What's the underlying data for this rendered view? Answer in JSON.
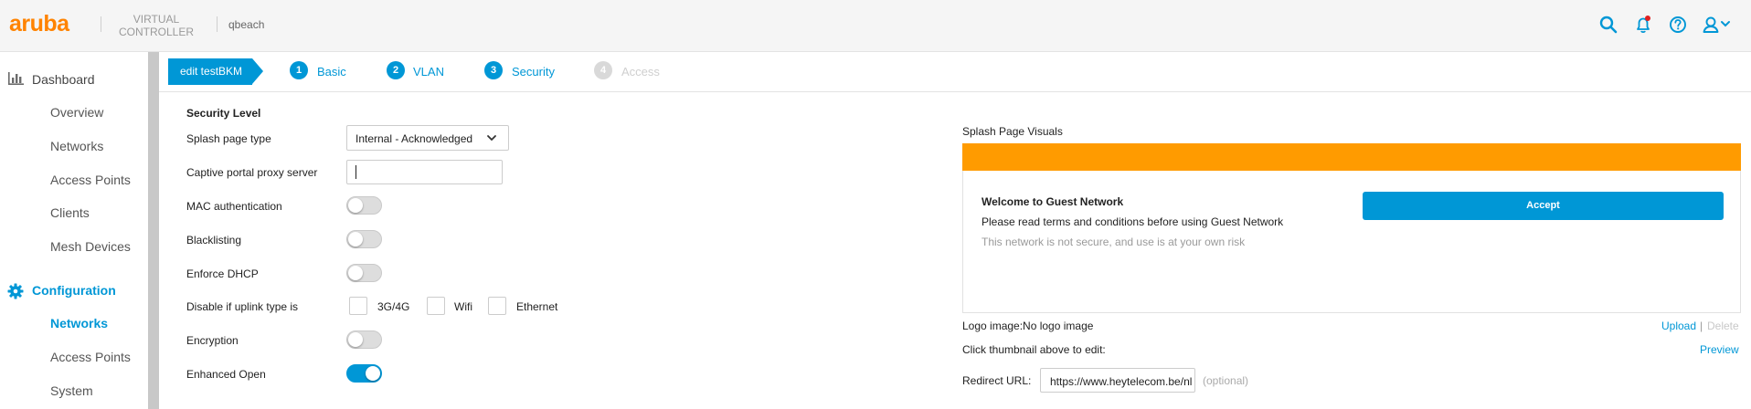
{
  "header": {
    "logo": "aruba",
    "product_line1": "VIRTUAL",
    "product_line2": "CONTROLLER",
    "host": "qbeach",
    "icons": [
      "search-icon",
      "bell-icon",
      "help-icon",
      "user-icon"
    ],
    "notification_dot_color": "#e02020"
  },
  "sidebar": {
    "dashboard": {
      "label": "Dashboard",
      "icon": "bar-chart-icon"
    },
    "dashboard_items": [
      "Overview",
      "Networks",
      "Access Points",
      "Clients",
      "Mesh Devices"
    ],
    "configuration": {
      "label": "Configuration",
      "icon": "gear-icon"
    },
    "configuration_items": [
      "Networks",
      "Access Points",
      "System"
    ],
    "active_item": "Networks"
  },
  "wizard": {
    "breadcrumb": "edit testBKM",
    "steps": [
      {
        "num": "1",
        "label": "Basic",
        "enabled": true
      },
      {
        "num": "2",
        "label": "VLAN",
        "enabled": true
      },
      {
        "num": "3",
        "label": "Security",
        "enabled": true
      },
      {
        "num": "4",
        "label": "Access",
        "enabled": false
      }
    ]
  },
  "security": {
    "title": "Security Level",
    "splash_type_label": "Splash page type",
    "splash_type_value": "Internal - Acknowledged",
    "proxy_label": "Captive portal proxy server",
    "proxy_value": "",
    "mac_label": "MAC authentication",
    "mac_on": false,
    "blacklist_label": "Blacklisting",
    "blacklist_on": false,
    "dhcp_label": "Enforce DHCP",
    "dhcp_on": false,
    "uplink_label": "Disable if uplink type is",
    "uplink_options": [
      "3G/4G",
      "Wifi",
      "Ethernet"
    ],
    "encryption_label": "Encryption",
    "encryption_on": false,
    "enhanced_label": "Enhanced Open",
    "enhanced_on": true
  },
  "splash": {
    "title": "Splash Page Visuals",
    "bar_color": "#ff9b00",
    "welcome": "Welcome to Guest Network",
    "terms": "Please read terms and conditions before using Guest Network",
    "warning": "This network is not secure, and use is at your own risk",
    "accept": "Accept",
    "logo_label": "Logo image:No logo image",
    "upload": "Upload",
    "separator": "|",
    "delete": "Delete",
    "thumb_label": "Click thumbnail above to edit:",
    "preview": "Preview",
    "redirect_label": "Redirect URL:",
    "redirect_value": "https://www.heytelecom.be/nl",
    "optional": "(optional)"
  },
  "colors": {
    "accent": "#0097d6",
    "brand": "#ff8300"
  }
}
